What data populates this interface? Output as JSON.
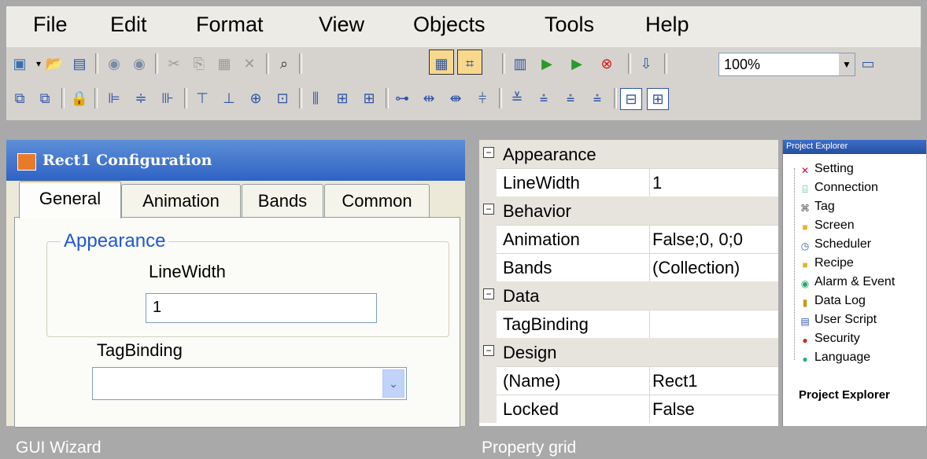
{
  "menubar": {
    "items": [
      "File",
      "Edit",
      "Format",
      "View",
      "Objects",
      "Tools",
      "Help"
    ]
  },
  "toolbar1": {
    "zoom_value": "100%"
  },
  "wizard": {
    "title": "Rect1 Configuration",
    "tabs": [
      "General",
      "Animation",
      "Bands",
      "Common"
    ],
    "active_tab": "General",
    "groupbox_label": "Appearance",
    "linewidth_label": "LineWidth",
    "linewidth_value": "1",
    "tagbinding_label": "TagBinding",
    "tagbinding_value": "",
    "caption": "GUI Wizard"
  },
  "property_grid": {
    "caption": "Property grid",
    "rows": [
      {
        "type": "category",
        "name": "Appearance"
      },
      {
        "type": "property",
        "name": "LineWidth",
        "value": "1"
      },
      {
        "type": "category",
        "name": "Behavior"
      },
      {
        "type": "property",
        "name": "Animation",
        "value": "False;0, 0;0"
      },
      {
        "type": "property",
        "name": "Bands",
        "value": "(Collection)"
      },
      {
        "type": "category",
        "name": "Data"
      },
      {
        "type": "property",
        "name": "TagBinding",
        "value": ""
      },
      {
        "type": "category",
        "name": "Design"
      },
      {
        "type": "property",
        "name": "(Name)",
        "value": "Rect1"
      },
      {
        "type": "property",
        "name": "Locked",
        "value": "False"
      }
    ]
  },
  "project_explorer": {
    "title": "Project Explorer",
    "items": [
      {
        "label": "Setting",
        "icon": "setting-icon"
      },
      {
        "label": "Connection",
        "icon": "connection-icon"
      },
      {
        "label": "Tag",
        "icon": "tag-icon"
      },
      {
        "label": "Screen",
        "icon": "folder-icon"
      },
      {
        "label": "Scheduler",
        "icon": "scheduler-icon"
      },
      {
        "label": "Recipe",
        "icon": "folder-icon"
      },
      {
        "label": "Alarm & Event",
        "icon": "alarm-icon"
      },
      {
        "label": "Data Log",
        "icon": "datalog-icon"
      },
      {
        "label": "User Script",
        "icon": "script-icon"
      },
      {
        "label": "Security",
        "icon": "security-icon"
      },
      {
        "label": "Language",
        "icon": "language-icon"
      }
    ],
    "footer": "Project Explorer"
  }
}
